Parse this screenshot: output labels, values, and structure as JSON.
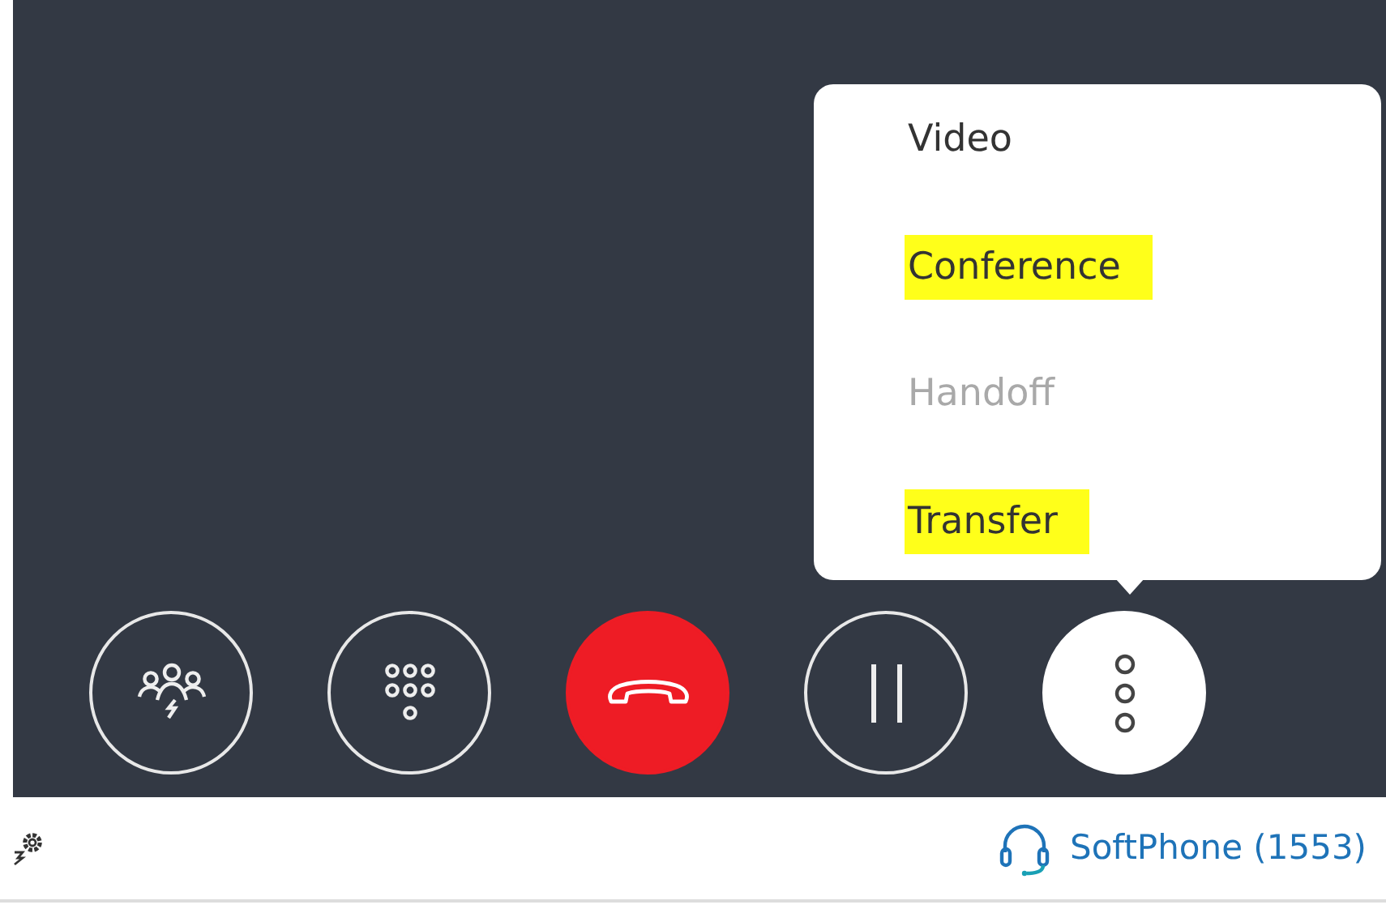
{
  "call_controls": [
    {
      "kind": "participants",
      "active": false
    },
    {
      "kind": "keypad",
      "active": false
    },
    {
      "kind": "hangup",
      "active": false
    },
    {
      "kind": "hold",
      "active": false
    },
    {
      "kind": "more",
      "active": true
    }
  ],
  "menu": {
    "items": [
      {
        "label": "Video",
        "disabled": false,
        "highlighted": false
      },
      {
        "label": "Conference",
        "disabled": false,
        "highlighted": true
      },
      {
        "label": "Handoff",
        "disabled": true,
        "highlighted": false
      },
      {
        "label": "Transfer",
        "disabled": false,
        "highlighted": true
      }
    ]
  },
  "status_bar": {
    "phone_label": "SoftPhone (1553)"
  }
}
